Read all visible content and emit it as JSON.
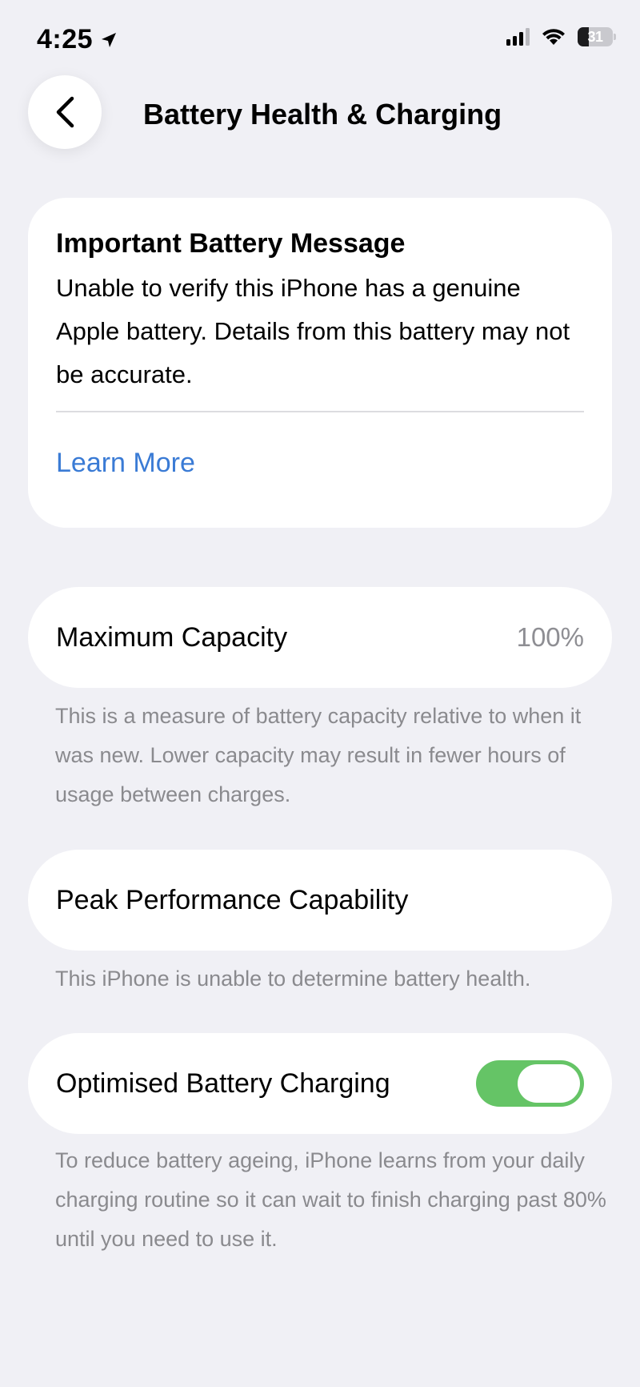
{
  "status_bar": {
    "time": "4:25",
    "battery_percent": "31",
    "battery_level": 0.31,
    "icons": [
      "location-arrow-icon",
      "cellular-signal-icon",
      "wifi-icon",
      "battery-icon"
    ]
  },
  "nav": {
    "back_icon": "chevron-left-icon",
    "title": "Battery Health & Charging"
  },
  "battery_message": {
    "title": "Important Battery Message",
    "body": "Unable to verify this iPhone has a genuine Apple battery. Details from this battery may not be accurate.",
    "link": "Learn More"
  },
  "maximum_capacity": {
    "label": "Maximum Capacity",
    "value": "100%",
    "footnote": "This is a measure of battery capacity relative to when it was new. Lower capacity may result in fewer hours of usage between charges."
  },
  "peak_performance": {
    "label": "Peak Performance Capability",
    "footnote": "This iPhone is unable to determine battery health."
  },
  "optimised_charging": {
    "label": "Optimised Battery Charging",
    "enabled": true,
    "footnote": "To reduce battery ageing, iPhone learns from your daily charging routine so it can wait to finish charging past 80% until you need to use it."
  },
  "colors": {
    "background": "#f0f0f5",
    "card": "#ffffff",
    "link": "#3a7bd5",
    "toggle_on": "#65c466",
    "secondary_text": "#8a8a8e"
  }
}
